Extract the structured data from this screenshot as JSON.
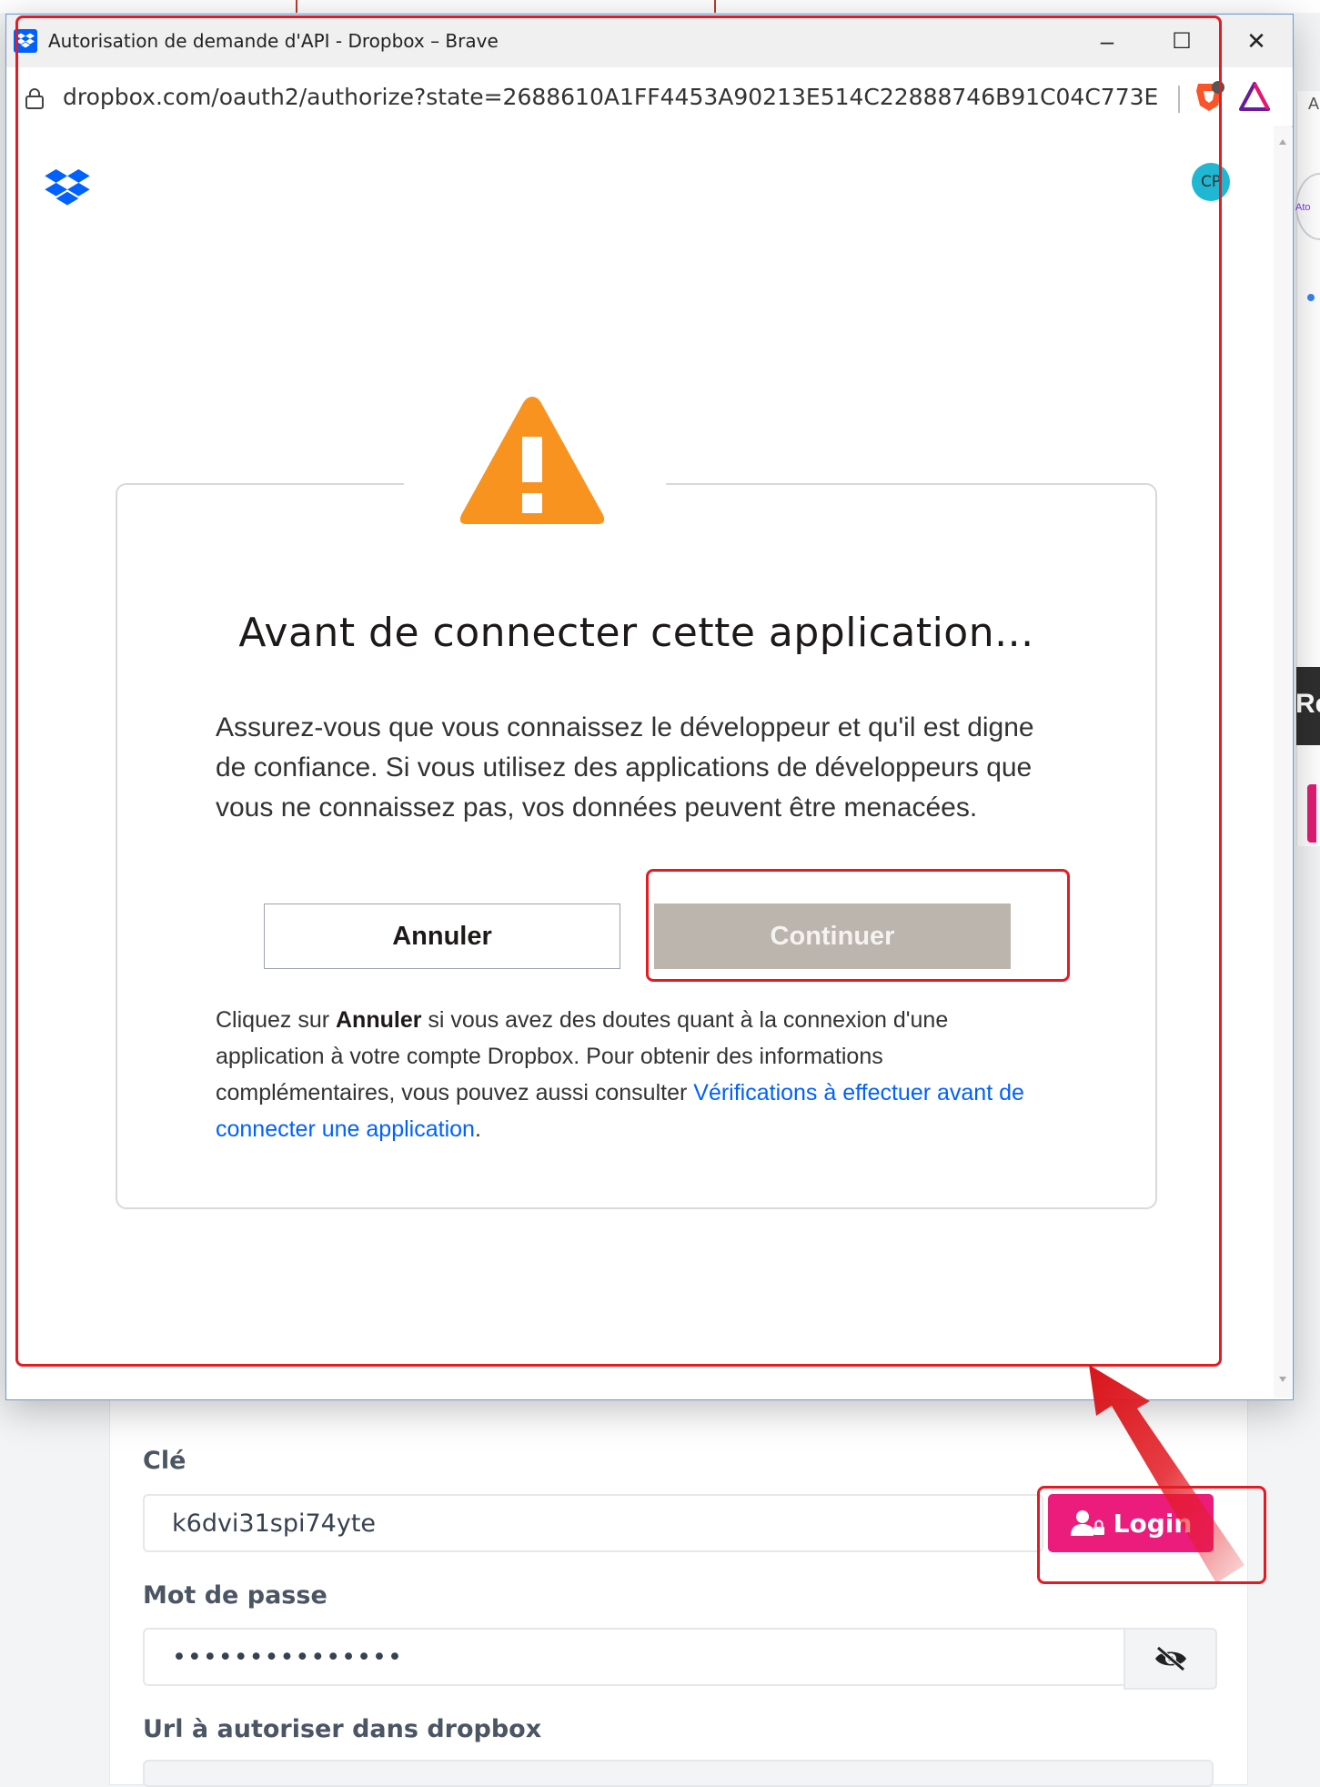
{
  "popup": {
    "window_title": "Autorisation de demande d'API - Dropbox – Brave",
    "controls": {
      "minimize": "–",
      "maximize": "☐",
      "close": "✕"
    },
    "url": "dropbox.com/oauth2/authorize?state=2688610A1FF4453A90213E514C22888746B91C04C773E82FD1D1...",
    "avatar_initials": "CP"
  },
  "dialog": {
    "heading": "Avant de connecter cette application...",
    "body": "Assurez-vous que vous connaissez le développeur et qu'il est digne de confiance. Si vous utilisez des applications de développeurs que vous ne connaissez pas, vos données peuvent être menacées.",
    "cancel_label": "Annuler",
    "continue_label": "Continuer",
    "footer_prefix": "Cliquez sur ",
    "footer_bold": "Annuler",
    "footer_middle": " si vous avez des doutes quant à la connexion d'une application à votre compte Dropbox. Pour obtenir des informations complémentaires, vous pouvez aussi consulter ",
    "footer_link": "Vérifications à effectuer avant de connecter une application",
    "footer_end": "."
  },
  "background": {
    "side_letter": "Re",
    "side_small": "Ato",
    "side_top": "A",
    "key_label": "Clé",
    "key_value": "k6dvi31spi74yte",
    "login_label": "Login",
    "password_label": "Mot de passe",
    "password_value": "•••••••••••••••",
    "url_label": "Url à autoriser dans dropbox"
  },
  "colors": {
    "dropbox_blue": "#0061fe",
    "warning_orange": "#f7931e",
    "login_pink": "#ec1c7c",
    "annotation_red": "#e31b23"
  }
}
